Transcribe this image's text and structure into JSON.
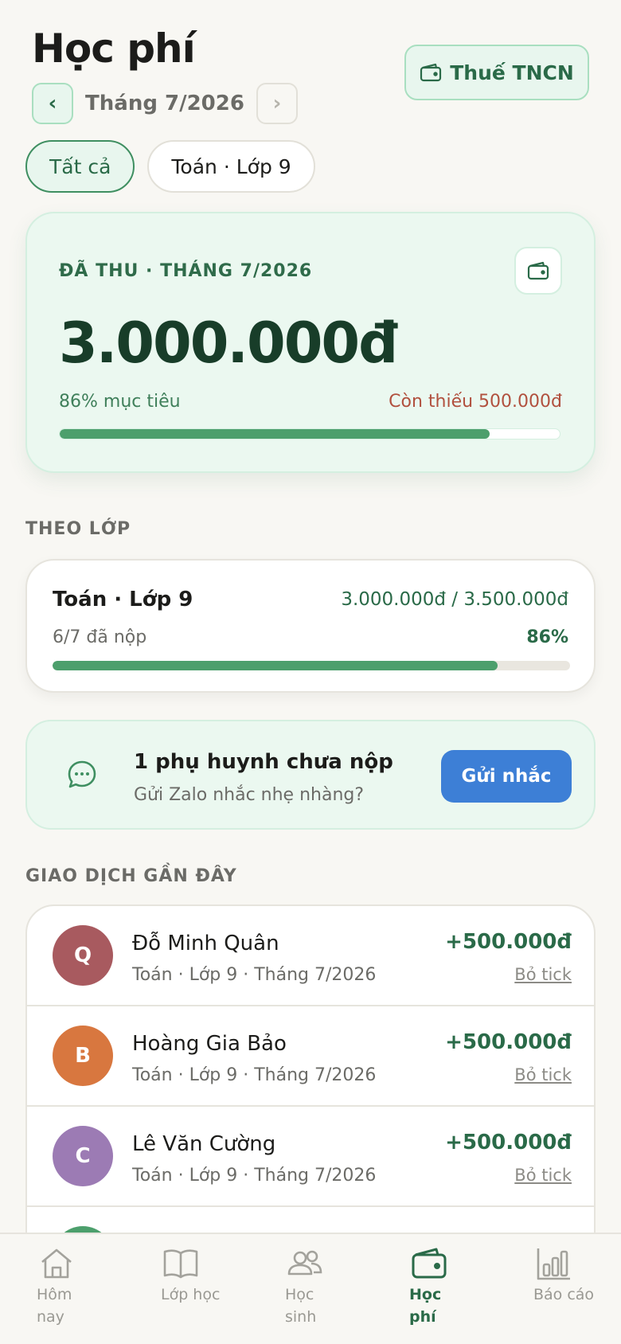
{
  "header": {
    "title": "Học phí",
    "tax_button": "Thuế TNCN",
    "month_prev": "‹",
    "month_label": "Tháng 7/2026",
    "month_next": "›"
  },
  "filters": [
    {
      "label": "Tất cả",
      "active": true
    },
    {
      "label": "Toán · Lớp 9",
      "active": false
    }
  ],
  "summary": {
    "label": "ĐÃ THU · THÁNG 7/2026",
    "amount": "3.000.000đ",
    "progress_text": "86% mục tiêu",
    "missing_text": "Còn thiếu 500.000đ",
    "progress": 0.86
  },
  "by_class": {
    "section_title": "THEO LỚP",
    "name": "Toán · Lớp 9",
    "amount": "3.000.000đ / 3.500.000đ",
    "paid": "6/7 đã nộp",
    "percent": "86%",
    "progress": 0.86
  },
  "reminder": {
    "title": "1 phụ huynh chưa nộp",
    "subtitle": "Gửi Zalo nhắc nhẹ nhàng?",
    "button": "Gửi nhắc"
  },
  "transactions": {
    "section_title": "GIAO DỊCH GẦN ĐÂY",
    "items": [
      {
        "initial": "Q",
        "name": "Đỗ Minh Quân",
        "meta": "Toán · Lớp 9 · Tháng 7/2026",
        "amount": "+500.000đ",
        "undo": "Bỏ tick",
        "color": "#a85a5f"
      },
      {
        "initial": "B",
        "name": "Hoàng Gia Bảo",
        "meta": "Toán · Lớp 9 · Tháng 7/2026",
        "amount": "+500.000đ",
        "undo": "Bỏ tick",
        "color": "#d8773f"
      },
      {
        "initial": "C",
        "name": "Lê Văn Cường",
        "meta": "Toán · Lớp 9 · Tháng 7/2026",
        "amount": "+500.000đ",
        "undo": "Bỏ tick",
        "color": "#9c7bb4"
      },
      {
        "initial": "",
        "name": "",
        "meta": "",
        "amount": "",
        "undo": "",
        "color": "#4c9f6c"
      }
    ]
  },
  "bottom_nav": [
    {
      "label": "Hôm nay",
      "icon": "home-icon",
      "active": false
    },
    {
      "label": "Lớp học",
      "icon": "book-icon",
      "active": false
    },
    {
      "label": "Học sinh",
      "icon": "users-icon",
      "active": false
    },
    {
      "label": "Học phí",
      "icon": "wallet-icon",
      "active": true
    },
    {
      "label": "Báo cáo",
      "icon": "bar-chart-icon",
      "active": false
    }
  ],
  "colors": {
    "accent_green": "#2a6a48",
    "progress_green": "#4c9f6c",
    "warning_red": "#b1503e",
    "button_blue": "#3d7fd6"
  }
}
